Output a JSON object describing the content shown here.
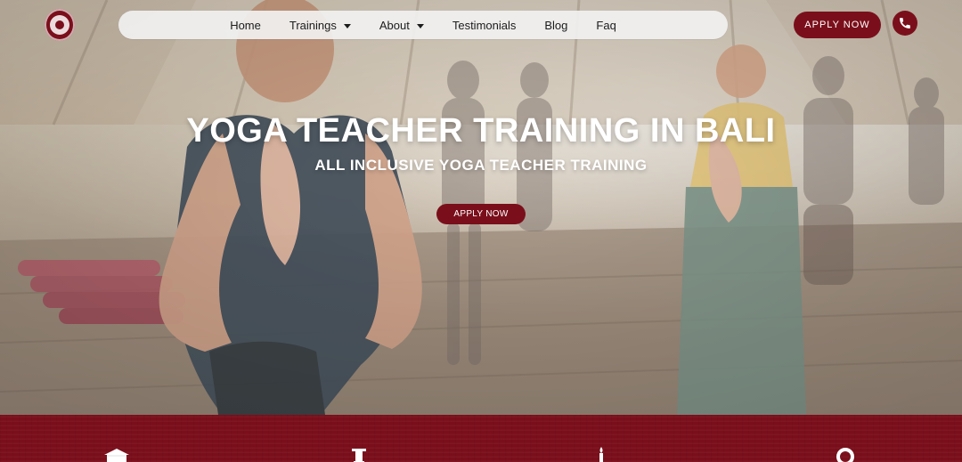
{
  "header": {
    "nav": [
      {
        "label": "Home",
        "has_caret": false
      },
      {
        "label": "Trainings",
        "has_caret": true
      },
      {
        "label": "About",
        "has_caret": true
      },
      {
        "label": "Testimonials",
        "has_caret": false
      },
      {
        "label": "Blog",
        "has_caret": false
      },
      {
        "label": "Faq",
        "has_caret": false
      }
    ],
    "apply_label": "APPLY NOW",
    "icons": {
      "phone": "phone-icon",
      "logo": "logo"
    }
  },
  "hero": {
    "title": "YOGA TEACHER TRAINING IN BALI",
    "subtitle": "ALL INCLUSIVE YOGA TEACHER TRAINING",
    "cta_label": "APPLY NOW"
  },
  "colors": {
    "brand": "#7a0f1b"
  },
  "band_icons": [
    "building-icon",
    "column-icon",
    "candle-icon",
    "ring-icon"
  ]
}
